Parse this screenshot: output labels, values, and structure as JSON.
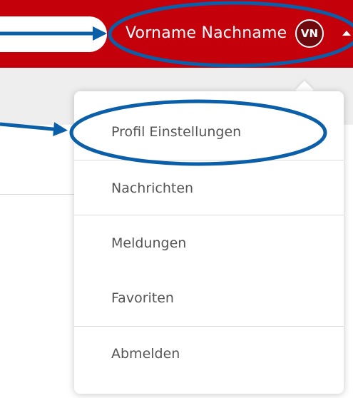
{
  "header": {
    "user_name": "Vorname Nachname",
    "avatar_initials": "VN"
  },
  "menu": {
    "items": [
      {
        "label": "Profil Einstellungen"
      },
      {
        "label": "Nachrichten"
      },
      {
        "label": "Meldungen"
      },
      {
        "label": "Favoriten"
      },
      {
        "label": "Abmelden"
      }
    ]
  },
  "colors": {
    "header_bg": "#c4000b",
    "avatar_bg": "#6e0a0e",
    "annotation": "#0a5fa8"
  },
  "icons": {
    "caret": "caret-up-icon",
    "annotation_arrows": [
      "arrow-right-icon",
      "arrow-right-icon"
    ]
  }
}
